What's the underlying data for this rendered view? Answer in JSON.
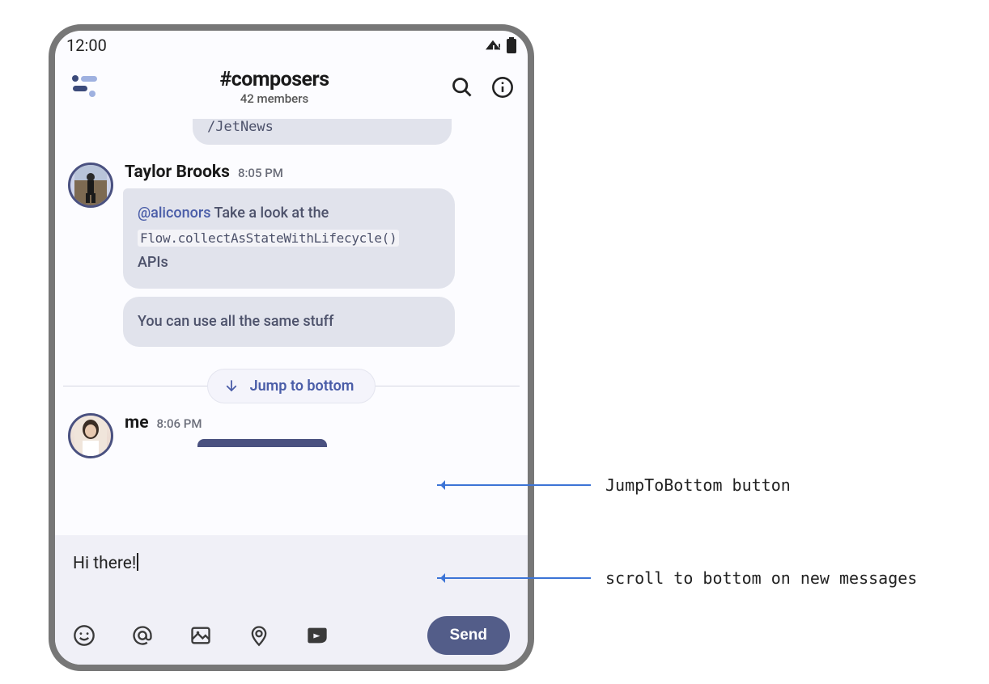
{
  "status_bar": {
    "time": "12:00"
  },
  "header": {
    "channel": "#composers",
    "members": "42 members"
  },
  "messages": {
    "partial_top": "/JetNews",
    "taylor": {
      "author": "Taylor Brooks",
      "time": "8:05 PM",
      "bubble1": {
        "mention": "@aliconors",
        "text1": " Take a look at the ",
        "code": "Flow.collectAsStateWithLifecycle()",
        "text2": "APIs"
      },
      "bubble2": "You can use all the same stuff"
    },
    "jump_label": "Jump to bottom",
    "me": {
      "author": "me",
      "time": "8:06 PM"
    }
  },
  "composer": {
    "text": "Hi there!",
    "send": "Send"
  },
  "annotations": {
    "a1": "JumpToBottom button",
    "a2": "scroll to bottom on new messages"
  }
}
